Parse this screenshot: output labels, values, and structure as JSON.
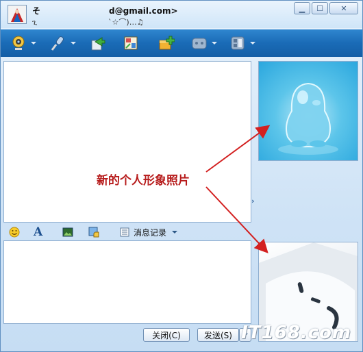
{
  "window": {
    "name_prefix": "そ",
    "email": "d@gmail.com>",
    "sig_prefix": "ጊ",
    "sig_suffix": "`☆⌒)…♫"
  },
  "toolbar": {
    "items": [
      "webcam-icon",
      "microphone-icon",
      "send-file-icon",
      "app-share-icon",
      "add-app-icon",
      "game-icon",
      "more-icon"
    ]
  },
  "format_bar": {
    "history_label": "消息记录"
  },
  "buttons": {
    "close_label": "关闭(C)",
    "send_label": "发送(S)"
  },
  "annotation": {
    "text": "新的个人形象照片"
  },
  "watermark": {
    "text": "IT168.com"
  },
  "colors": {
    "toolbar_blue": "#1a6bb6",
    "annotation_red": "#b71c1c",
    "arrow_red": "#d32020"
  }
}
